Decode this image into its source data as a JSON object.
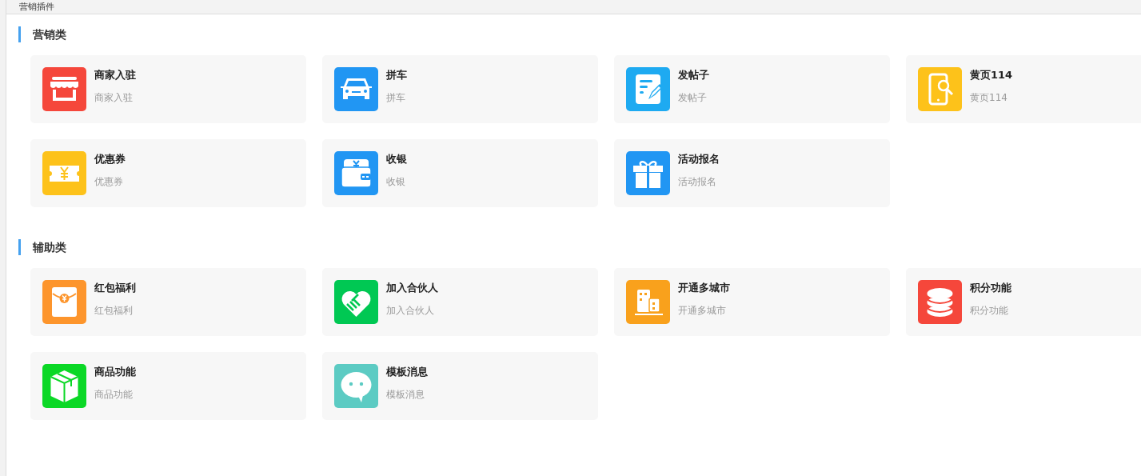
{
  "header": {
    "title": "营销插件"
  },
  "sections": [
    {
      "title": "营销类",
      "items": [
        {
          "title": "商家入驻",
          "subtitle": "商家入驻",
          "color": "#f5473b"
        },
        {
          "title": "拼车",
          "subtitle": "拼车",
          "color": "#2196f3"
        },
        {
          "title": "发帖子",
          "subtitle": "发帖子",
          "color": "#1eaaf1"
        },
        {
          "title": "黄页114",
          "subtitle": "黄页114",
          "color": "#fdc21a"
        },
        {
          "title": "优惠券",
          "subtitle": "优惠券",
          "color": "#fdc21a"
        },
        {
          "title": "收银",
          "subtitle": "收银",
          "color": "#2196f3"
        },
        {
          "title": "活动报名",
          "subtitle": "活动报名",
          "color": "#2196f3"
        }
      ]
    },
    {
      "title": "辅助类",
      "items": [
        {
          "title": "红包福利",
          "subtitle": "红包福利",
          "color": "#fd952c"
        },
        {
          "title": "加入合伙人",
          "subtitle": "加入合伙人",
          "color": "#00c853"
        },
        {
          "title": "开通多城市",
          "subtitle": "开通多城市",
          "color": "#f9a11c"
        },
        {
          "title": "积分功能",
          "subtitle": "积分功能",
          "color": "#f5473b"
        },
        {
          "title": "商品功能",
          "subtitle": "商品功能",
          "color": "#0bd826"
        },
        {
          "title": "模板消息",
          "subtitle": "模板消息",
          "color": "#5ccbc3"
        }
      ]
    }
  ]
}
